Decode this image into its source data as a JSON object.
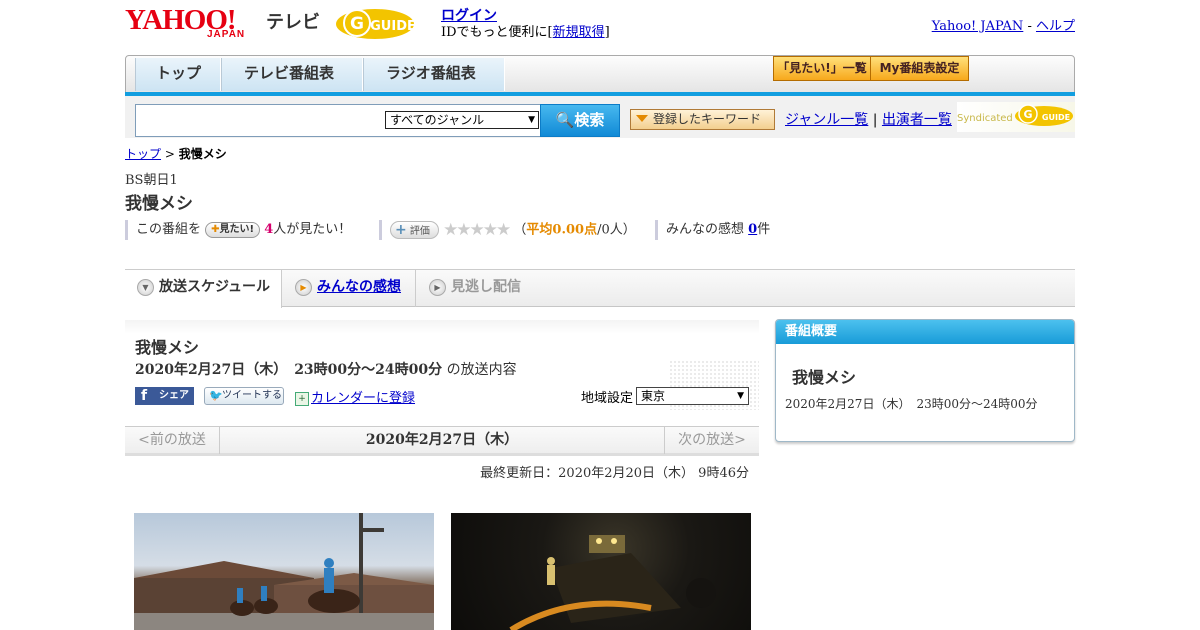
{
  "header": {
    "yahoo_logo": "YAHOO!",
    "japan_text": "JAPAN",
    "tv_text": "テレビ",
    "gguide_logo": "GUIDE",
    "login_link": "ログイン",
    "login_prompt": "IDでもっと便利に[",
    "signup_link": "新規取得",
    "login_suffix": "]",
    "yahoo_japan_link": "Yahoo! JAPAN",
    "separator": " - ",
    "help_link": "ヘルプ"
  },
  "nav": {
    "tabs": [
      "トップ",
      "テレビ番組表",
      "ラジオ番組表"
    ],
    "mitai_list_btn": "「見たい!」一覧",
    "my_schedule_btn": "My番組表設定"
  },
  "search": {
    "genre_selected": "すべてのジャンル",
    "search_btn": "検索",
    "keyword_btn": "登録したキーワード",
    "genre_list_link": "ジャンル一覧",
    "divider": "|",
    "performer_list_link": "出演者一覧",
    "syndicated_text": "Syndicated",
    "gguide_mini": "GUIDE"
  },
  "breadcrumb": {
    "top_link": "トップ",
    "sep": " > ",
    "current": "我慢メシ"
  },
  "program": {
    "station": "BS朝日1",
    "title": "我慢メシ",
    "mitai_prefix": "この番組を",
    "mitai_btn": "見たい!",
    "mitai_count": "4",
    "mitai_suffix": "人が見たい！",
    "hyoka_btn": "評価",
    "stars": "★★★★★",
    "avg_open": "（",
    "avg_label": "平均0.00点",
    "avg_people": "/0人）",
    "review_label": "みんなの感想",
    "review_count": "0",
    "review_suffix": "件"
  },
  "tabs": {
    "schedule": "放送スケジュール",
    "reviews": "みんなの感想",
    "missed": "見逃し配信"
  },
  "main": {
    "title": "我慢メシ",
    "date_bold": "2020年2月27日（木）　23時00分～24時00分",
    "date_suffix": " の放送内容",
    "share_btn": "シェア",
    "tweet_btn": "ツイートする",
    "calendar_link": "カレンダーに登録",
    "region_label": "地域設定",
    "region_selected": "東京",
    "prev": "<前の放送",
    "current_date": "2020年2月27日（木）",
    "next": "次の放送>",
    "updated": "最終更新日：2020年2月20日（木） 9時46分"
  },
  "sidebar": {
    "header": "番組概要",
    "title": "我慢メシ",
    "time": "2020年2月27日（木）　23時00分～24時00分"
  },
  "colors": {
    "accent_blue": "#129ee0",
    "yahoo_red": "#e60012",
    "gguide_yellow": "#f3c400",
    "orange": "#e58a00"
  }
}
